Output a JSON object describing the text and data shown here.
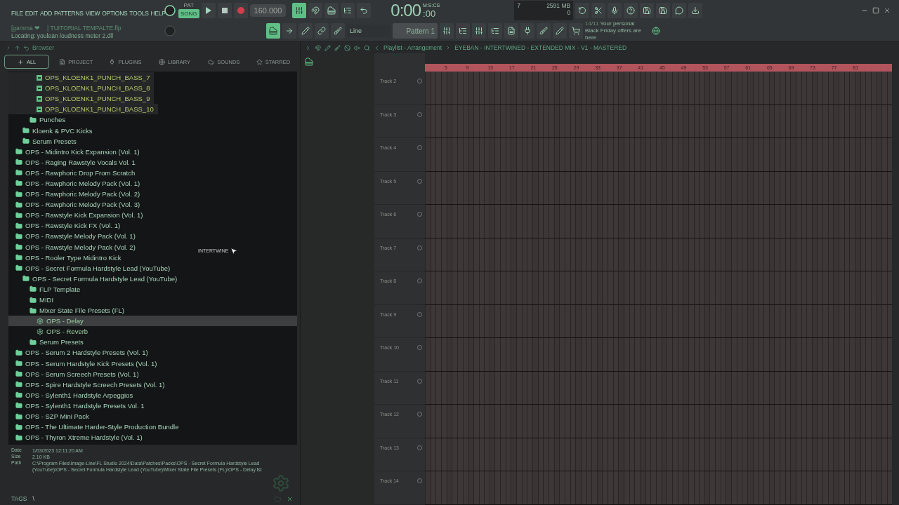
{
  "menu": [
    "FILE",
    "EDIT",
    "ADD",
    "PATTERNS",
    "VIEW",
    "OPTIONS",
    "TOOLS",
    "HELP"
  ],
  "project": {
    "user": "[gamma ❤",
    "file": "| TUITORIAL TEMPALTE.flp",
    "status": "Locating: youlean loudness meter 2.dll"
  },
  "transport": {
    "modes": [
      {
        "label": "PAT",
        "selected": false
      },
      {
        "label": "SONG",
        "selected": true
      }
    ],
    "tempo": "160.000",
    "time": "0:00",
    "time_small": ":00",
    "time_unit": "M:S:CS"
  },
  "monitor": {
    "cpu": "7",
    "memory": "2591 MB",
    "polyphony": "0"
  },
  "snap": {
    "value": "Line"
  },
  "pattern": {
    "value": "Pattern 1"
  },
  "news": {
    "date": "14/11",
    "text": "Your personal Black Friday offers are here"
  },
  "browser": {
    "title": "Browser",
    "tabs": [
      {
        "label": "ALL",
        "selected": true
      },
      {
        "label": "PROJECT",
        "selected": false
      },
      {
        "label": "PLUGINS",
        "selected": false
      },
      {
        "label": "LIBRARY",
        "selected": false
      },
      {
        "label": "SOUNDS",
        "selected": false
      },
      {
        "label": "STARRED",
        "selected": false
      }
    ],
    "tree": [
      {
        "children": [
          {
            "children": [
              {
                "children": [
                  {
                    "kind": "file",
                    "label": "OPS_KLOENK1_PUNCH_BASS_7",
                    "selected": false
                  },
                  {
                    "kind": "file",
                    "label": "OPS_KLOENK1_PUNCH_BASS_8",
                    "selected": false
                  },
                  {
                    "kind": "file",
                    "label": "OPS_KLOENK1_PUNCH_BASS_9",
                    "selected": false
                  },
                  {
                    "kind": "file",
                    "label": "OPS_KLOENK1_PUNCH_BASS_10",
                    "selected": false
                  }
                ]
              },
              {
                "kind": "folder",
                "label": "Punches",
                "selected": false
              }
            ]
          },
          {
            "kind": "folder",
            "label": "Kloenk & PVC Kicks",
            "selected": false
          },
          {
            "kind": "folder",
            "label": "Serum Presets",
            "selected": false
          }
        ]
      },
      {
        "kind": "folder",
        "label": "OPS - Midintro Kick Expansion (Vol. 1)",
        "selected": false
      },
      {
        "kind": "folder",
        "label": "OPS - Raging Rawstyle Vocals Vol. 1",
        "selected": false
      },
      {
        "kind": "folder",
        "label": "OPS - Rawphoric Drop From Scratch",
        "selected": false
      },
      {
        "kind": "folder",
        "label": "OPS - Rawphoric Melody Pack (Vol. 1)",
        "selected": false
      },
      {
        "kind": "folder",
        "label": "OPS - Rawphoric Melody Pack (Vol. 2)",
        "selected": false
      },
      {
        "kind": "folder",
        "label": "OPS - Rawphoric Melody Pack (Vol. 3)",
        "selected": false
      },
      {
        "kind": "folder",
        "label": "OPS - Rawstyle Kick Expansion (Vol. 1)",
        "selected": false
      },
      {
        "kind": "folder",
        "label": "OPS - Rawstyle Kick FX (Vol. 1)",
        "selected": false
      },
      {
        "kind": "folder",
        "label": "OPS - Rawstyle Melody Pack (Vol. 1)",
        "selected": false
      },
      {
        "kind": "folder",
        "label": "OPS - Rawstyle Melody Pack (Vol. 2)",
        "selected": false
      },
      {
        "kind": "folder",
        "label": "OPS - Rooler Type Midintro Kick",
        "selected": false
      },
      {
        "kind": "folder",
        "label": "OPS - Secret Formula Hardstyle Lead (YouTube)",
        "selected": false,
        "children": [
          {
            "kind": "folder",
            "label": "OPS - Secret Formula Hardstyle Lead (YouTube)",
            "selected": false,
            "children": [
              {
                "kind": "folder",
                "label": "FLP Template",
                "selected": false
              },
              {
                "kind": "folder",
                "label": "MIDI",
                "selected": false
              },
              {
                "kind": "folder",
                "label": "Mixer State File Presets (FL)",
                "selected": false,
                "children": [
                  {
                    "kind": "preset",
                    "label": "OPS - Delay",
                    "selected": true
                  },
                  {
                    "kind": "preset",
                    "label": "OPS - Reverb",
                    "selected": false
                  }
                ]
              },
              {
                "kind": "folder",
                "label": "Serum Presets",
                "selected": false
              }
            ]
          }
        ]
      },
      {
        "kind": "folder",
        "label": "OPS - Serum 2 Hardstyle Presets (Vol. 1)",
        "selected": false
      },
      {
        "kind": "folder",
        "label": "OPS - Serum Hardstyle Kick Presets (Vol. 1)",
        "selected": false
      },
      {
        "kind": "folder",
        "label": "OPS - Serum Screech Presets (Vol. 1)",
        "selected": false
      },
      {
        "kind": "folder",
        "label": "OPS - Spire Hardstyle Screech Presets (Vol. 1)",
        "selected": false
      },
      {
        "kind": "folder",
        "label": "OPS - Sylenth1 Hardstyle Arpeggios",
        "selected": false
      },
      {
        "kind": "folder",
        "label": "OPS - Sylenth1 Hardstyle Presets Vol. 1",
        "selected": false
      },
      {
        "kind": "folder",
        "label": "OPS - SZP Mini Pack",
        "selected": false
      },
      {
        "kind": "folder",
        "label": "OPS - The Ultimate Harder-Style Production Bundle",
        "selected": false
      },
      {
        "kind": "folder",
        "label": "OPS - Thyron Xtreme Hardstyle (Vol. 1)",
        "selected": false
      }
    ],
    "drag_label": "INTERTWINE",
    "info": [
      {
        "label": "Date",
        "value": "1/03/2023 12:11:20 AM"
      },
      {
        "label": "Size",
        "value": "2.10 KB"
      },
      {
        "label": "Path",
        "value": "C:\\Program Files\\Image-Line\\FL Studio 2024\\Data\\Patches\\Packs\\OPS - Secret Formula Hardstyle Lead (YouTube)\\OPS - Secret Formula Hardstyle Lead (YouTube)\\Mixer State File Presets (FL)\\OPS - Delay.fst"
      }
    ],
    "tags_label": "TAGS",
    "tags_value": "\\"
  },
  "playlist": {
    "title": "Playlist - Arrangement",
    "song": "EYEBAN - INTERTWINED - EXTENDED MIX - V1 - MASTERED",
    "bars": [
      "5",
      "9",
      "13",
      "17",
      "21",
      "25",
      "29",
      "33",
      "37",
      "41",
      "45",
      "49",
      "53",
      "57",
      "61",
      "65",
      "69",
      "73",
      "77",
      "81"
    ],
    "tracks": [
      "Track 2",
      "Track 3",
      "Track 4",
      "Track 5",
      "Track 6",
      "Track 7",
      "Track 8",
      "Track 9",
      "Track 10",
      "Track 11",
      "Track 12",
      "Track 13",
      "Track 14"
    ]
  }
}
